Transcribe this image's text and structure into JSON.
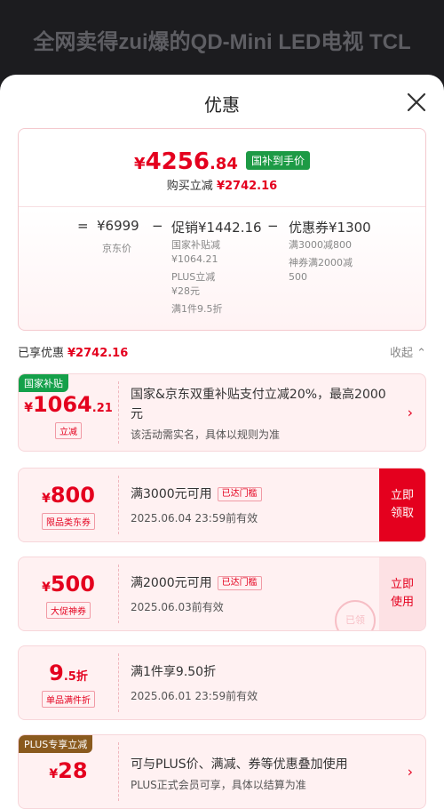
{
  "background_title": "全网卖得zui爆的QD-Mini LED电视 TCL",
  "sheet": {
    "title": "优惠"
  },
  "summary": {
    "currency": "¥",
    "final_int": "4256",
    "final_frac": ".84",
    "final_tag": "国补到手价",
    "saved_label": "购买立减",
    "saved_value": "¥2742.16",
    "formula": {
      "eq": "=",
      "jd_price": "¥6999",
      "jd_label": "京东价",
      "minus1": "−",
      "promo": "促销¥1442.16",
      "promo_lines": [
        "国家补贴减",
        "¥1064.21",
        "PLUS立减",
        "¥28元",
        "满1件9.5折"
      ],
      "minus2": "−",
      "coupon": "优惠券¥1300",
      "coupon_lines": [
        "满3000减800",
        "神券满2000减",
        "500"
      ]
    }
  },
  "applied": {
    "label": "已享优惠",
    "value": "¥2742.16",
    "collapse": "收起 ⌃"
  },
  "coupons": [
    {
      "badge": "国家补贴",
      "currency": "¥",
      "amount": "1064",
      "suffix": ".21",
      "tag": "立减",
      "title": "国家&京东双重补贴支付立减20%，最高2000元",
      "sub": "该活动需实名，具体以规则为准",
      "chevron": "›"
    },
    {
      "currency": "¥",
      "amount": "800",
      "tag": "限品类东券",
      "title": "满3000元可用",
      "reached": "已达门槛",
      "sub": "2025.06.04  23:59前有效",
      "action": [
        "立即",
        "领取"
      ]
    },
    {
      "currency": "¥",
      "amount": "500",
      "tag": "大促神券",
      "title": "满2000元可用",
      "reached": "已达门槛",
      "sub": "2025.06.03前有效",
      "action": [
        "立即",
        "使用"
      ],
      "stamp": "已领"
    },
    {
      "amount": "9",
      "suffix": ".5折",
      "tag": "单品满件折",
      "title": "满1件享9.50折",
      "sub": "2025.06.01  23:59前有效"
    },
    {
      "badge": "PLUS专享立减",
      "currency": "¥",
      "amount": "28",
      "title": "可与PLUS价、满减、券等优惠叠加使用",
      "sub": "PLUS正式会员可享，具体以结算为准",
      "chevron": "›"
    }
  ],
  "colors": {
    "accent": "#e4001e",
    "green": "#1d9a45",
    "plus": "#8a5a1e"
  }
}
